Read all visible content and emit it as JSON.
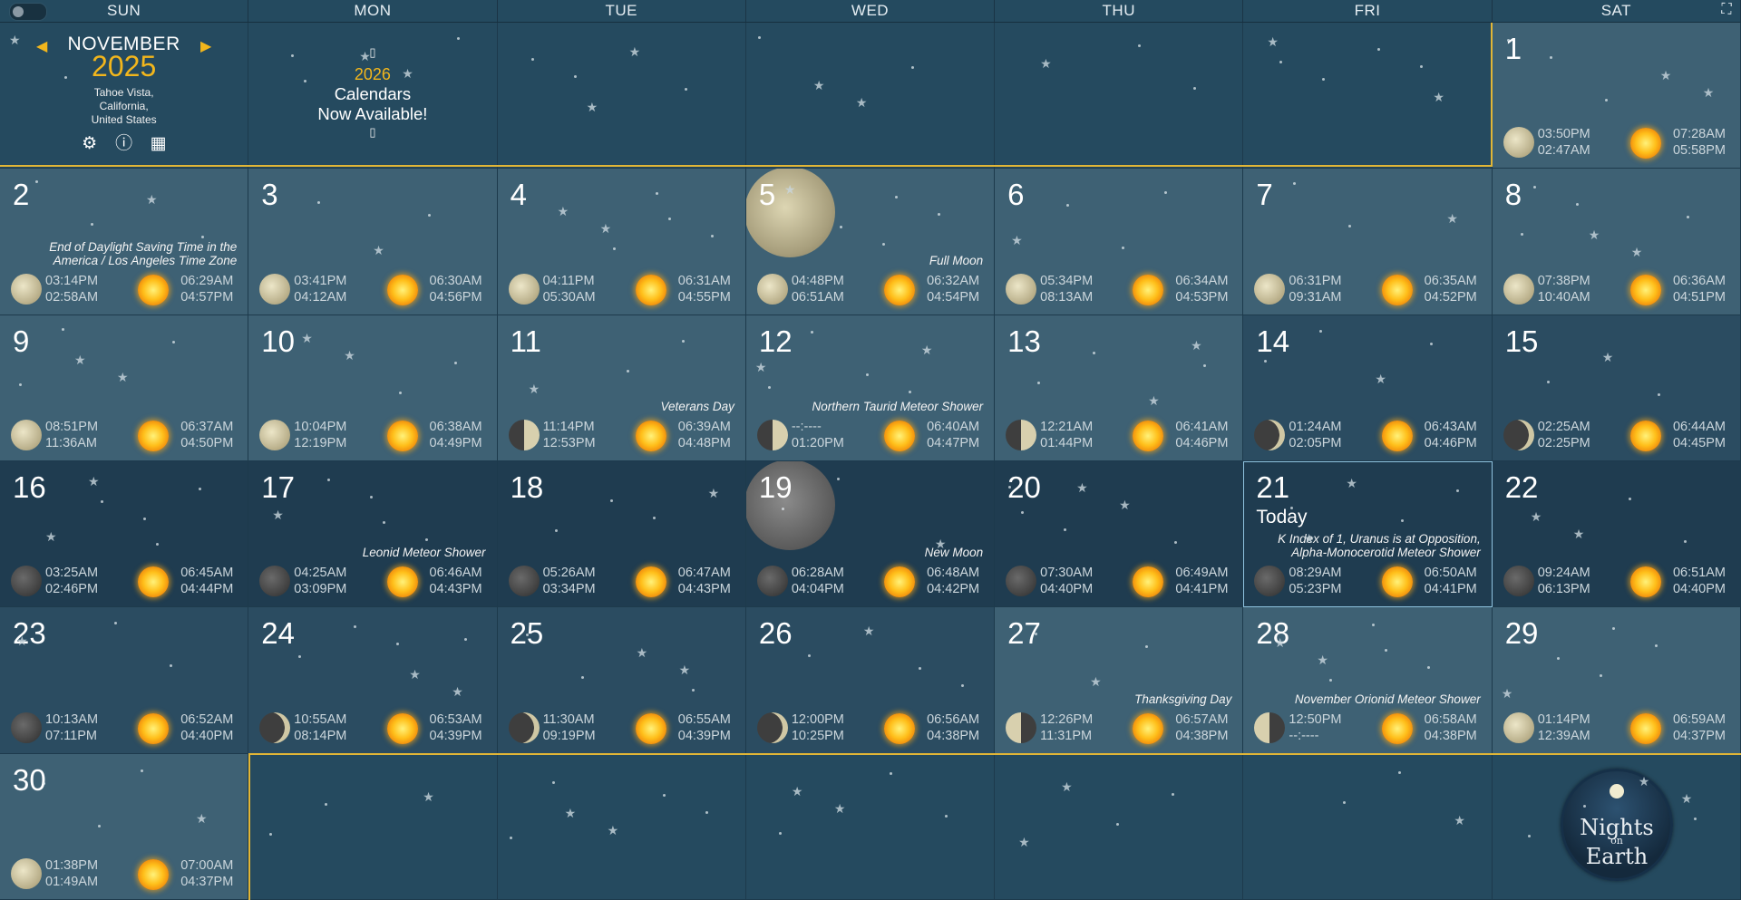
{
  "app": {
    "theme_toggle_icon": "toggle-switch",
    "fullscreen_icon": "fullscreen-icon"
  },
  "weekdays": [
    "SUN",
    "MON",
    "TUE",
    "WED",
    "THU",
    "FRI",
    "SAT"
  ],
  "nav": {
    "month": "NOVEMBER",
    "year": "2025",
    "location": [
      "Tahoe Vista,",
      "California,",
      "United States"
    ],
    "prev_icon": "caret-left-icon",
    "next_icon": "caret-right-icon",
    "icons": [
      "gear-icon",
      "info-icon",
      "store-icon"
    ]
  },
  "promo": {
    "year": "2026",
    "line1": "Calendars",
    "line2": "Now Available!",
    "glyph": "▯"
  },
  "days": [
    {
      "d": "1",
      "moon": [
        "03:50PM",
        "02:47AM"
      ],
      "sun": [
        "07:28AM",
        "05:58PM"
      ],
      "phase": "full"
    },
    {
      "d": "2",
      "moon": [
        "03:14PM",
        "02:58AM"
      ],
      "sun": [
        "06:29AM",
        "04:57PM"
      ],
      "phase": "full",
      "event": "End of Daylight Saving Time in the America / Los Angeles Time Zone"
    },
    {
      "d": "3",
      "moon": [
        "03:41PM",
        "04:12AM"
      ],
      "sun": [
        "06:30AM",
        "04:56PM"
      ],
      "phase": "full"
    },
    {
      "d": "4",
      "moon": [
        "04:11PM",
        "05:30AM"
      ],
      "sun": [
        "06:31AM",
        "04:55PM"
      ],
      "phase": "full"
    },
    {
      "d": "5",
      "moon": [
        "04:48PM",
        "06:51AM"
      ],
      "sun": [
        "06:32AM",
        "04:54PM"
      ],
      "phase": "full",
      "event": "Full Moon"
    },
    {
      "d": "6",
      "moon": [
        "05:34PM",
        "08:13AM"
      ],
      "sun": [
        "06:34AM",
        "04:53PM"
      ],
      "phase": "full"
    },
    {
      "d": "7",
      "moon": [
        "06:31PM",
        "09:31AM"
      ],
      "sun": [
        "06:35AM",
        "04:52PM"
      ],
      "phase": "full"
    },
    {
      "d": "8",
      "moon": [
        "07:38PM",
        "10:40AM"
      ],
      "sun": [
        "06:36AM",
        "04:51PM"
      ],
      "phase": "full"
    },
    {
      "d": "9",
      "moon": [
        "08:51PM",
        "11:36AM"
      ],
      "sun": [
        "06:37AM",
        "04:50PM"
      ],
      "phase": "full"
    },
    {
      "d": "10",
      "moon": [
        "10:04PM",
        "12:19PM"
      ],
      "sun": [
        "06:38AM",
        "04:49PM"
      ],
      "phase": "full"
    },
    {
      "d": "11",
      "moon": [
        "11:14PM",
        "12:53PM"
      ],
      "sun": [
        "06:39AM",
        "04:48PM"
      ],
      "phase": "half",
      "event": "Veterans Day"
    },
    {
      "d": "12",
      "moon": [
        "--:----",
        "01:20PM"
      ],
      "sun": [
        "06:40AM",
        "04:47PM"
      ],
      "phase": "half",
      "event": "Northern Taurid Meteor Shower"
    },
    {
      "d": "13",
      "moon": [
        "12:21AM",
        "01:44PM"
      ],
      "sun": [
        "06:41AM",
        "04:46PM"
      ],
      "phase": "half"
    },
    {
      "d": "14",
      "moon": [
        "01:24AM",
        "02:05PM"
      ],
      "sun": [
        "06:43AM",
        "04:46PM"
      ],
      "phase": "crescent"
    },
    {
      "d": "15",
      "moon": [
        "02:25AM",
        "02:25PM"
      ],
      "sun": [
        "06:44AM",
        "04:45PM"
      ],
      "phase": "crescent"
    },
    {
      "d": "16",
      "moon": [
        "03:25AM",
        "02:46PM"
      ],
      "sun": [
        "06:45AM",
        "04:44PM"
      ],
      "phase": "new"
    },
    {
      "d": "17",
      "moon": [
        "04:25AM",
        "03:09PM"
      ],
      "sun": [
        "06:46AM",
        "04:43PM"
      ],
      "phase": "new",
      "event": "Leonid Meteor Shower"
    },
    {
      "d": "18",
      "moon": [
        "05:26AM",
        "03:34PM"
      ],
      "sun": [
        "06:47AM",
        "04:43PM"
      ],
      "phase": "new"
    },
    {
      "d": "19",
      "moon": [
        "06:28AM",
        "04:04PM"
      ],
      "sun": [
        "06:48AM",
        "04:42PM"
      ],
      "phase": "new",
      "event": "New Moon"
    },
    {
      "d": "20",
      "moon": [
        "07:30AM",
        "04:40PM"
      ],
      "sun": [
        "06:49AM",
        "04:41PM"
      ],
      "phase": "new"
    },
    {
      "d": "21",
      "moon": [
        "08:29AM",
        "05:23PM"
      ],
      "sun": [
        "06:50AM",
        "04:41PM"
      ],
      "phase": "new",
      "event": "K Index of 1, Uranus is at Opposition, Alpha-Monocerotid Meteor Shower",
      "today": "Today"
    },
    {
      "d": "22",
      "moon": [
        "09:24AM",
        "06:13PM"
      ],
      "sun": [
        "06:51AM",
        "04:40PM"
      ],
      "phase": "new"
    },
    {
      "d": "23",
      "moon": [
        "10:13AM",
        "07:11PM"
      ],
      "sun": [
        "06:52AM",
        "04:40PM"
      ],
      "phase": "new"
    },
    {
      "d": "24",
      "moon": [
        "10:55AM",
        "08:14PM"
      ],
      "sun": [
        "06:53AM",
        "04:39PM"
      ],
      "phase": "crescent"
    },
    {
      "d": "25",
      "moon": [
        "11:30AM",
        "09:19PM"
      ],
      "sun": [
        "06:55AM",
        "04:39PM"
      ],
      "phase": "crescent"
    },
    {
      "d": "26",
      "moon": [
        "12:00PM",
        "10:25PM"
      ],
      "sun": [
        "06:56AM",
        "04:38PM"
      ],
      "phase": "crescent"
    },
    {
      "d": "27",
      "moon": [
        "12:26PM",
        "11:31PM"
      ],
      "sun": [
        "06:57AM",
        "04:38PM"
      ],
      "phase": "half-r",
      "event": "Thanksgiving Day"
    },
    {
      "d": "28",
      "moon": [
        "12:50PM",
        "--:----"
      ],
      "sun": [
        "06:58AM",
        "04:38PM"
      ],
      "phase": "half-r",
      "event": "November Orionid Meteor Shower"
    },
    {
      "d": "29",
      "moon": [
        "01:14PM",
        "12:39AM"
      ],
      "sun": [
        "06:59AM",
        "04:37PM"
      ],
      "phase": "full"
    },
    {
      "d": "30",
      "moon": [
        "01:38PM",
        "01:49AM"
      ],
      "sun": [
        "07:00AM",
        "04:37PM"
      ],
      "phase": "full"
    }
  ],
  "logo": {
    "line1": "Nights",
    "line2": "on",
    "line3": "Earth"
  },
  "colors": {
    "accent": "#f2b61c",
    "cell": "#3e6174",
    "cell_dark": "#2b4c61",
    "header": "#244a5f"
  }
}
